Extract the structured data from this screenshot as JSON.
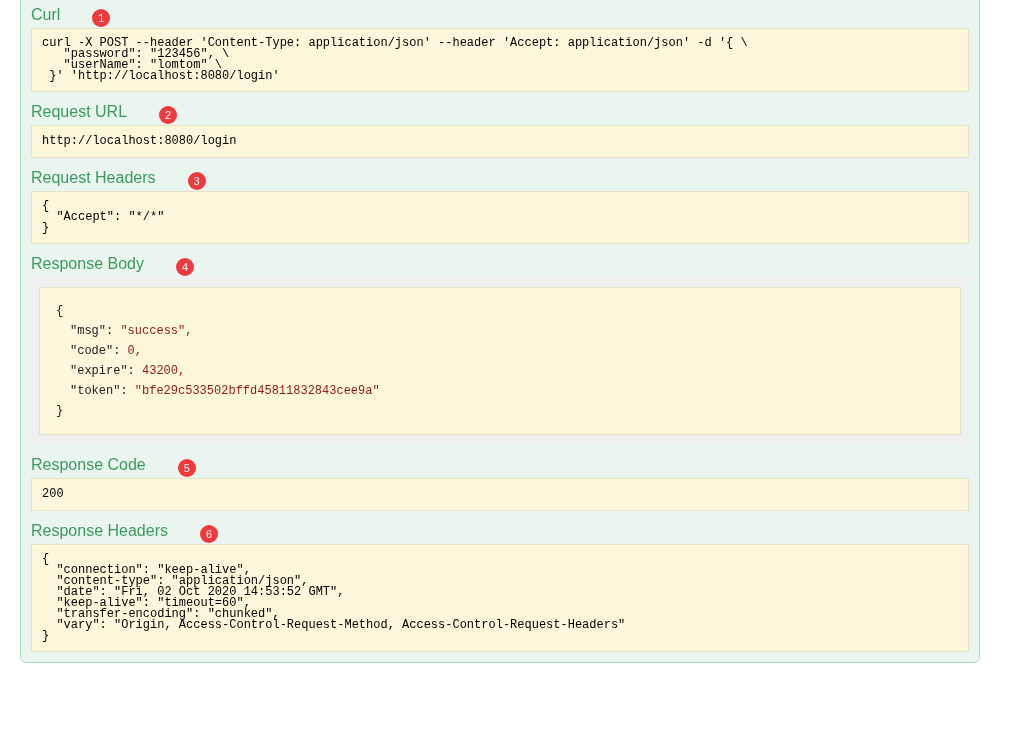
{
  "sections": [
    {
      "kind": "code",
      "heading": "Curl",
      "badge": "1",
      "lines": [
        "curl -X POST --header 'Content-Type: application/json' --header 'Accept: application/json' -d '{ \\",
        "   \"password\": \"123456\", \\",
        "   \"userName\": \"lomtom\" \\",
        " }' 'http://localhost:8080/login'"
      ]
    },
    {
      "kind": "code",
      "heading": "Request URL",
      "badge": "2",
      "lines": [
        "http://localhost:8080/login"
      ]
    },
    {
      "kind": "code",
      "heading": "Request Headers",
      "badge": "3",
      "lines": [
        "{",
        "  \"Accept\": \"*/*\"",
        "}"
      ]
    },
    {
      "kind": "json",
      "heading": "Response Body",
      "badge": "4",
      "lines": [
        {
          "text": "{"
        },
        {
          "key": "\"msg\": ",
          "value": "\"success\","
        },
        {
          "key": "\"code\": ",
          "value": "0,"
        },
        {
          "key": "\"expire\": ",
          "value": "43200,"
        },
        {
          "key": "\"token\": ",
          "value": "\"bfe29c533502bffd45811832843cee9a\""
        },
        {
          "text": "}"
        }
      ]
    },
    {
      "kind": "code",
      "heading": "Response Code",
      "badge": "5",
      "lines": [
        "200"
      ]
    },
    {
      "kind": "code",
      "heading": "Response Headers",
      "badge": "6",
      "lines": [
        "{",
        "  \"connection\": \"keep-alive\",",
        "  \"content-type\": \"application/json\",",
        "  \"date\": \"Fri, 02 Oct 2020 14:53:52 GMT\",",
        "  \"keep-alive\": \"timeout=60\",",
        "  \"transfer-encoding\": \"chunked\",",
        "  \"vary\": \"Origin, Access-Control-Request-Method, Access-Control-Request-Headers\"",
        "}"
      ]
    }
  ]
}
